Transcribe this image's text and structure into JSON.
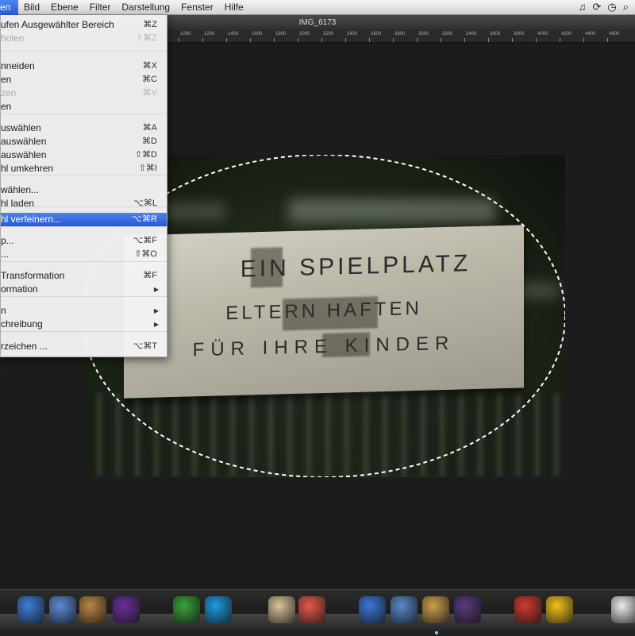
{
  "menubar": {
    "active_menu": "en",
    "items": [
      "Bild",
      "Ebene",
      "Filter",
      "Darstellung",
      "Fenster",
      "Hilfe"
    ],
    "tray_icons": [
      "music-note-icon",
      "sync-icon",
      "time-machine-icon",
      "search-icon"
    ]
  },
  "window": {
    "title": "IMG_6173"
  },
  "ruler": {
    "ticks": [
      "1000",
      "1200",
      "1400",
      "1600",
      "1800",
      "2000",
      "2200",
      "2400",
      "2600",
      "2800",
      "3000",
      "3200",
      "3400",
      "3600",
      "3800",
      "4000",
      "4200",
      "4400",
      "4600"
    ]
  },
  "menu": {
    "items": [
      {
        "label": "ufen Ausgewählter Bereich",
        "shortcut": "⌘Z",
        "enabled": true
      },
      {
        "label": "holen",
        "shortcut": "⇧⌘Z",
        "enabled": false
      },
      {
        "label": "nneiden",
        "shortcut": "⌘X",
        "enabled": true
      },
      {
        "label": "en",
        "shortcut": "⌘C",
        "enabled": true
      },
      {
        "label": "zen",
        "shortcut": "⌘V",
        "enabled": false
      },
      {
        "label": "en",
        "shortcut": "",
        "enabled": true
      },
      {
        "label": "uswählen",
        "shortcut": "⌘A",
        "enabled": true
      },
      {
        "label": "auswählen",
        "shortcut": "⌘D",
        "enabled": true
      },
      {
        "label": "auswählen",
        "shortcut": "⇧⌘D",
        "enabled": true
      },
      {
        "label": "hl umkehren",
        "shortcut": "⇧⌘I",
        "enabled": true
      },
      {
        "label": "wählen...",
        "shortcut": "",
        "enabled": true
      },
      {
        "label": "hl laden",
        "shortcut": "⌥⌘L",
        "enabled": true
      },
      {
        "label": "hl verfeinern...",
        "shortcut": "⌥⌘R",
        "enabled": true,
        "highlighted": true
      },
      {
        "label": "p...",
        "shortcut": "⌥⌘F",
        "enabled": true
      },
      {
        "label": "...",
        "shortcut": "⇧⌘O",
        "enabled": true
      },
      {
        "label": "Transformation",
        "shortcut": "⌘F",
        "enabled": true
      },
      {
        "label": "ormation",
        "shortcut": "",
        "submenu": true,
        "enabled": true
      },
      {
        "label": "n",
        "shortcut": "",
        "submenu": true,
        "enabled": true
      },
      {
        "label": "chreibung",
        "shortcut": "",
        "submenu": true,
        "enabled": true
      },
      {
        "label": "rzeichen ...",
        "shortcut": "⌥⌘T",
        "enabled": true
      }
    ]
  },
  "photo": {
    "sign_lines": [
      "EIN SPIELPLATZ",
      "ELTERN HAFTEN",
      "FÜR IHRE KINDER"
    ]
  },
  "dock": {
    "icons": [
      "safari-icon",
      "preview-icon",
      "ichat-icon",
      "photobooth-icon",
      "adium-icon",
      "skype-icon",
      "address-book-icon",
      "ical-icon",
      "itunes-icon",
      "iphoto-icon",
      "pixelmator-icon",
      "front-row-icon",
      "app-store-icon",
      "cyberduck-icon",
      "text-edit-icon"
    ]
  }
}
